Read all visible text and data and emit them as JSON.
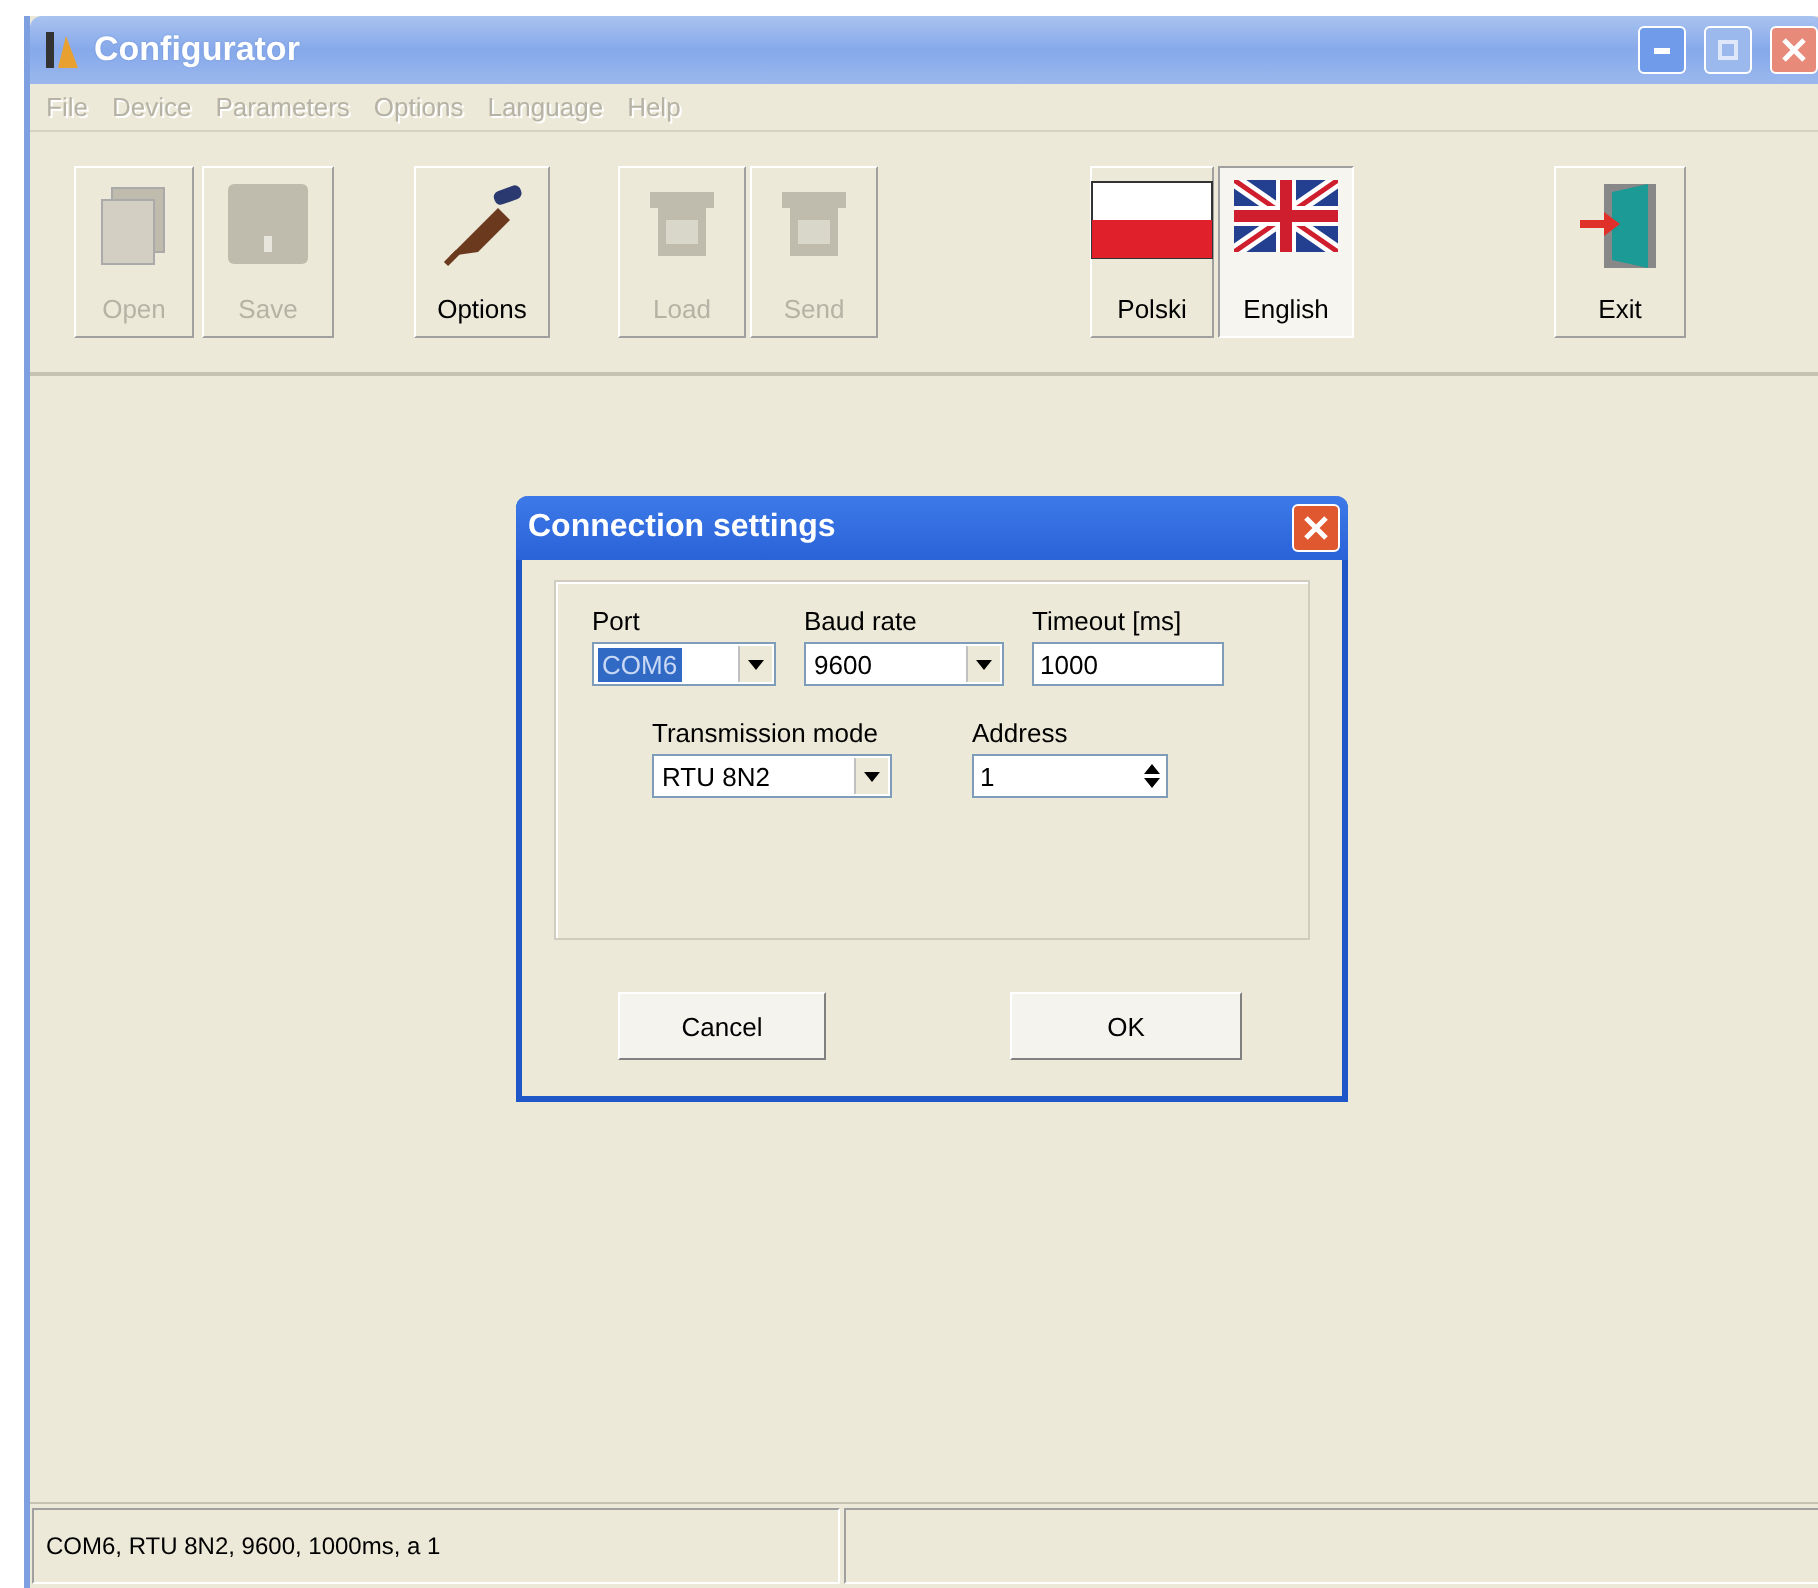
{
  "window": {
    "title": "Configurator"
  },
  "menu": [
    {
      "label": "File",
      "disabled": true
    },
    {
      "label": "Device",
      "disabled": true
    },
    {
      "label": "Parameters",
      "disabled": true
    },
    {
      "label": "Options",
      "disabled": true
    },
    {
      "label": "Language",
      "disabled": true
    },
    {
      "label": "Help",
      "disabled": true
    }
  ],
  "toolbar": [
    {
      "kind": "open",
      "label": "Open",
      "disabled": true,
      "selected": false
    },
    {
      "kind": "save",
      "label": "Save",
      "disabled": true,
      "selected": false
    },
    {
      "kind": "options",
      "label": "Options",
      "disabled": false,
      "selected": false
    },
    {
      "kind": "load",
      "label": "Load",
      "disabled": true,
      "selected": false
    },
    {
      "kind": "send",
      "label": "Send",
      "disabled": true,
      "selected": false
    },
    {
      "kind": "flag-pl",
      "label": "Polski",
      "disabled": false,
      "selected": false
    },
    {
      "kind": "flag-uk",
      "label": "English",
      "disabled": false,
      "selected": true
    },
    {
      "kind": "exit",
      "label": "Exit",
      "disabled": false,
      "selected": false
    }
  ],
  "dialog": {
    "title": "Connection settings",
    "port": {
      "label": "Port",
      "value": "COM6",
      "highlighted": true
    },
    "baud_rate": {
      "label": "Baud rate",
      "value": "9600"
    },
    "timeout": {
      "label": "Timeout [ms]",
      "value": "1000"
    },
    "transmission_mode": {
      "label": "Transmission mode",
      "value": "RTU 8N2"
    },
    "address": {
      "label": "Address",
      "value": "1"
    },
    "buttons": [
      "Cancel",
      "OK"
    ]
  },
  "status_bar": [
    "COM6, RTU 8N2, 9600, 1000ms, a 1"
  ]
}
